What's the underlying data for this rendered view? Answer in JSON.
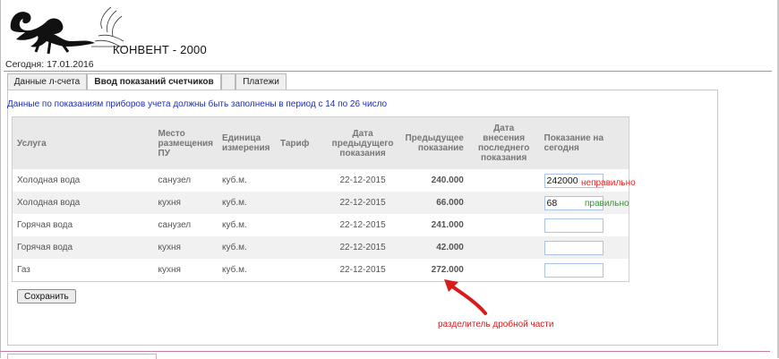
{
  "brand": "КОНВЕНТ - 2000",
  "today": "Сегодня: 17.01.2016",
  "tabs": [
    {
      "label": "Данные л-счета",
      "active": false
    },
    {
      "label": "Ввод показаний счетчиков",
      "active": true
    },
    {
      "label": "",
      "active": false
    },
    {
      "label": "Платежи",
      "active": false
    }
  ],
  "notice": "Данные по показаниям приборов учета должны быть заполнены в период с 14 по 26 число",
  "table": {
    "headers": [
      "Услуга",
      "Место размещения ПУ",
      "Единица измерения",
      "Тариф",
      "Дата предыдущего показания",
      "Предыдущее показание",
      "Дата внесения последнего показания",
      "Показание на сегодня"
    ],
    "rows": [
      {
        "service": "Холодная вода",
        "place": "санузел",
        "unit": "куб.м.",
        "tariff": "",
        "prev_date": "22-12-2015",
        "prev_value": "240.000",
        "last_date": "",
        "today": "242000"
      },
      {
        "service": "Холодная вода",
        "place": "кухня",
        "unit": "куб.м.",
        "tariff": "",
        "prev_date": "22-12-2015",
        "prev_value": "66.000",
        "last_date": "",
        "today": "68"
      },
      {
        "service": "Горячая вода",
        "place": "санузел",
        "unit": "куб.м.",
        "tariff": "",
        "prev_date": "22-12-2015",
        "prev_value": "241.000",
        "last_date": "",
        "today": ""
      },
      {
        "service": "Горячая вода",
        "place": "кухня",
        "unit": "куб.м.",
        "tariff": "",
        "prev_date": "22-12-2015",
        "prev_value": "42.000",
        "last_date": "",
        "today": ""
      },
      {
        "service": "Газ",
        "place": "кухня",
        "unit": "куб.м.",
        "tariff": "",
        "prev_date": "22-12-2015",
        "prev_value": "272.000",
        "last_date": "",
        "today": ""
      }
    ]
  },
  "annotations": {
    "wrong": "неправильно",
    "right": "правильно",
    "separator": "разделитель дробной части"
  },
  "save_label": "Сохранить",
  "colors": {
    "notice": "#1f2fb5",
    "wrong": "#e22222",
    "right": "#2c9a2c",
    "arrow": "#d81b1b"
  },
  "icons": {
    "logo": "lizard-logo",
    "arrow": "red-arrow-icon"
  }
}
